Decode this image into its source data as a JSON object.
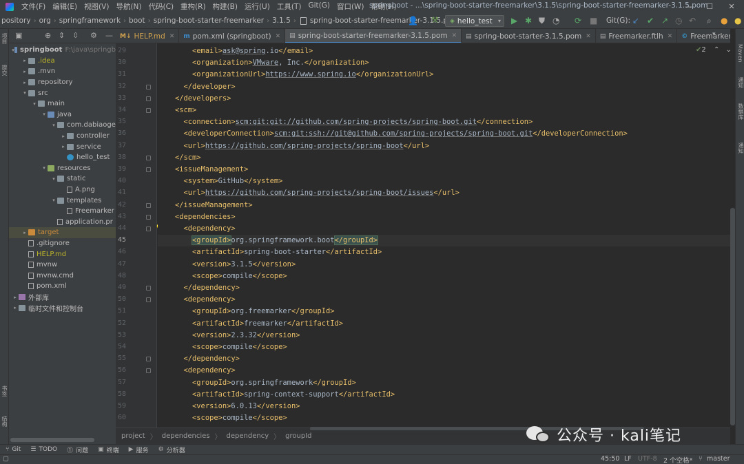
{
  "menubar": {
    "items": [
      "文件(F)",
      "编辑(E)",
      "视图(V)",
      "导航(N)",
      "代码(C)",
      "重构(R)",
      "构建(B)",
      "运行(U)",
      "工具(T)",
      "Git(G)",
      "窗口(W)",
      "帮助(H)"
    ],
    "window_title": "springboot - ...\\spring-boot-starter-freemarker\\3.1.5\\spring-boot-starter-freemarker-3.1.5.pom",
    "window_buttons": [
      "—",
      "☐",
      "✕"
    ]
  },
  "navbar": {
    "crumbs": [
      "pository",
      "org",
      "springframework",
      "boot",
      "spring-boot-starter-freemarker",
      "3.1.5"
    ],
    "file": "spring-boot-starter-freemarker-3.1.5.pom",
    "run_config": "hello_test",
    "git_label": "Git(G):"
  },
  "sidebar_stripe": {
    "left_top": "项目",
    "left_mid": "提交",
    "left_bottom1": "书签",
    "left_bottom2": "结构"
  },
  "right_stripe": {
    "maven": "Maven",
    "notify": "通知",
    "database": "数据库",
    "big_data": "通知"
  },
  "project_tree": [
    {
      "label": "springboot",
      "suffix": "F:\\java\\springb",
      "depth": 0,
      "arrow": "▾",
      "icon": "folder-b",
      "bold": true
    },
    {
      "label": ".idea",
      "depth": 1,
      "arrow": "▸",
      "icon": "folder",
      "style": "yellow"
    },
    {
      "label": ".mvn",
      "depth": 1,
      "arrow": "▸",
      "icon": "folder"
    },
    {
      "label": "repository",
      "depth": 1,
      "arrow": "▸",
      "icon": "folder"
    },
    {
      "label": "src",
      "depth": 1,
      "arrow": "▾",
      "icon": "folder"
    },
    {
      "label": "main",
      "depth": 2,
      "arrow": "▾",
      "icon": "folder"
    },
    {
      "label": "java",
      "depth": 3,
      "arrow": "▾",
      "icon": "folder-b"
    },
    {
      "label": "com.dabiaoge",
      "depth": 4,
      "arrow": "▾",
      "icon": "folder"
    },
    {
      "label": "controller",
      "depth": 5,
      "arrow": "▸",
      "icon": "folder"
    },
    {
      "label": "service",
      "depth": 5,
      "arrow": "▸",
      "icon": "folder"
    },
    {
      "label": "hello_test",
      "depth": 5,
      "arrow": "",
      "icon": "java"
    },
    {
      "label": "resources",
      "depth": 3,
      "arrow": "▾",
      "icon": "folder-g"
    },
    {
      "label": "static",
      "depth": 4,
      "arrow": "▾",
      "icon": "folder"
    },
    {
      "label": "A.png",
      "depth": 5,
      "arrow": "",
      "icon": "file"
    },
    {
      "label": "templates",
      "depth": 4,
      "arrow": "▾",
      "icon": "folder"
    },
    {
      "label": "Freemarker",
      "depth": 5,
      "arrow": "",
      "icon": "file"
    },
    {
      "label": "application.pr",
      "depth": 4,
      "arrow": "",
      "icon": "file"
    },
    {
      "label": "target",
      "depth": 1,
      "arrow": "▸",
      "icon": "folder-o",
      "style": "orange",
      "selected": true
    },
    {
      "label": ".gitignore",
      "depth": 1,
      "arrow": "",
      "icon": "file"
    },
    {
      "label": "HELP.md",
      "depth": 1,
      "arrow": "",
      "icon": "file",
      "style": "yellow"
    },
    {
      "label": "mvnw",
      "depth": 1,
      "arrow": "",
      "icon": "file"
    },
    {
      "label": "mvnw.cmd",
      "depth": 1,
      "arrow": "",
      "icon": "file"
    },
    {
      "label": "pom.xml",
      "depth": 1,
      "arrow": "",
      "icon": "file"
    },
    {
      "label": "外部库",
      "depth": 0,
      "arrow": "▸",
      "icon": "lib"
    },
    {
      "label": "临时文件和控制台",
      "depth": 0,
      "arrow": "▸",
      "icon": "folder"
    }
  ],
  "tabs": [
    {
      "label": "HELP.md",
      "icon": "M↓",
      "color": "#d0a24f"
    },
    {
      "label": "pom.xml (springboot)",
      "icon": "m",
      "color": "#bbbbbb"
    },
    {
      "label": "spring-boot-starter-freemarker-3.1.5.pom",
      "icon": "▤",
      "color": "#bbbbbb",
      "active": true
    },
    {
      "label": "spring-boot-starter-3.1.5.pom",
      "icon": "▤",
      "color": "#bbbbbb"
    },
    {
      "label": "Freemarker.ftlh",
      "icon": "▤",
      "color": "#bbbbbb"
    },
    {
      "label": "FreemarkerIndexCont",
      "icon": "©",
      "color": "#bbbbbb"
    }
  ],
  "editor": {
    "first_line": 29,
    "current_line": 45,
    "inspection_count": "2",
    "lines": [
      [
        {
          "t": "        "
        },
        {
          "c": "tg",
          "t": "<email>"
        },
        {
          "c": "ul",
          "t": "ask"
        },
        {
          "t": "@"
        },
        {
          "c": "ul",
          "t": "spring"
        },
        {
          "t": ".io"
        },
        {
          "c": "tg",
          "t": "</email>"
        }
      ],
      [
        {
          "t": "        "
        },
        {
          "c": "tg",
          "t": "<organization>"
        },
        {
          "c": "ul",
          "t": "VMware"
        },
        {
          "t": ", Inc."
        },
        {
          "c": "tg",
          "t": "</organization>"
        }
      ],
      [
        {
          "t": "        "
        },
        {
          "c": "tg",
          "t": "<organizationUrl>"
        },
        {
          "c": "ul",
          "t": "https://www.spring.io"
        },
        {
          "c": "tg",
          "t": "</organizationUrl>"
        }
      ],
      [
        {
          "t": "      "
        },
        {
          "c": "tg",
          "t": "</developer>"
        }
      ],
      [
        {
          "t": "    "
        },
        {
          "c": "tg",
          "t": "</developers>"
        }
      ],
      [
        {
          "t": "    "
        },
        {
          "c": "tg",
          "t": "<scm>"
        }
      ],
      [
        {
          "t": "      "
        },
        {
          "c": "tg",
          "t": "<connection>"
        },
        {
          "c": "ul",
          "t": "scm:git:git://github.com/spring-projects/spring-boot.git"
        },
        {
          "c": "tg",
          "t": "</connection>"
        }
      ],
      [
        {
          "t": "      "
        },
        {
          "c": "tg",
          "t": "<developerConnection>"
        },
        {
          "c": "ul",
          "t": "scm:git:ssh://git@github.com/spring-projects/spring-boot.git"
        },
        {
          "c": "tg",
          "t": "</developerConnection>"
        }
      ],
      [
        {
          "t": "      "
        },
        {
          "c": "tg",
          "t": "<url>"
        },
        {
          "c": "ul",
          "t": "https://github.com/spring-projects/spring-boot"
        },
        {
          "c": "tg",
          "t": "</url>"
        }
      ],
      [
        {
          "t": "    "
        },
        {
          "c": "tg",
          "t": "</scm>"
        }
      ],
      [
        {
          "t": "    "
        },
        {
          "c": "tg",
          "t": "<issueManagement>"
        }
      ],
      [
        {
          "t": "      "
        },
        {
          "c": "tg",
          "t": "<system>"
        },
        {
          "t": "GitHub"
        },
        {
          "c": "tg",
          "t": "</system>"
        }
      ],
      [
        {
          "t": "      "
        },
        {
          "c": "tg",
          "t": "<url>"
        },
        {
          "c": "ul",
          "t": "https://github.com/spring-projects/spring-boot/issues"
        },
        {
          "c": "tg",
          "t": "</url>"
        }
      ],
      [
        {
          "t": "    "
        },
        {
          "c": "tg",
          "t": "</issueManagement>"
        }
      ],
      [
        {
          "t": "    "
        },
        {
          "c": "tg",
          "t": "<dependencies>"
        }
      ],
      [
        {
          "t": "      "
        },
        {
          "c": "tg",
          "t": "<dependency>"
        }
      ],
      [
        {
          "t": "        "
        },
        {
          "c": "tg hl",
          "t": "<groupId>"
        },
        {
          "t": "org.springframework.boot"
        },
        {
          "c": "tg hl",
          "t": "</groupId>"
        }
      ],
      [
        {
          "t": "        "
        },
        {
          "c": "tg",
          "t": "<artifactId>"
        },
        {
          "t": "spring-boot-starter"
        },
        {
          "c": "tg",
          "t": "</artifactId>"
        }
      ],
      [
        {
          "t": "        "
        },
        {
          "c": "tg",
          "t": "<version>"
        },
        {
          "t": "3.1.5"
        },
        {
          "c": "tg",
          "t": "</version>"
        }
      ],
      [
        {
          "t": "        "
        },
        {
          "c": "tg",
          "t": "<scope>"
        },
        {
          "t": "compile"
        },
        {
          "c": "tg",
          "t": "</scope>"
        }
      ],
      [
        {
          "t": "      "
        },
        {
          "c": "tg",
          "t": "</dependency>"
        }
      ],
      [
        {
          "t": "      "
        },
        {
          "c": "tg",
          "t": "<dependency>"
        }
      ],
      [
        {
          "t": "        "
        },
        {
          "c": "tg",
          "t": "<groupId>"
        },
        {
          "t": "org.freemarker"
        },
        {
          "c": "tg",
          "t": "</groupId>"
        }
      ],
      [
        {
          "t": "        "
        },
        {
          "c": "tg",
          "t": "<artifactId>"
        },
        {
          "t": "freemarker"
        },
        {
          "c": "tg",
          "t": "</artifactId>"
        }
      ],
      [
        {
          "t": "        "
        },
        {
          "c": "tg",
          "t": "<version>"
        },
        {
          "t": "2.3.32"
        },
        {
          "c": "tg",
          "t": "</version>"
        }
      ],
      [
        {
          "t": "        "
        },
        {
          "c": "tg",
          "t": "<scope>"
        },
        {
          "t": "compile"
        },
        {
          "c": "tg",
          "t": "</scope>"
        }
      ],
      [
        {
          "t": "      "
        },
        {
          "c": "tg",
          "t": "</dependency>"
        }
      ],
      [
        {
          "t": "      "
        },
        {
          "c": "tg",
          "t": "<dependency>"
        }
      ],
      [
        {
          "t": "        "
        },
        {
          "c": "tg",
          "t": "<groupId>"
        },
        {
          "t": "org.springframework"
        },
        {
          "c": "tg",
          "t": "</groupId>"
        }
      ],
      [
        {
          "t": "        "
        },
        {
          "c": "tg",
          "t": "<artifactId>"
        },
        {
          "t": "spring-context-support"
        },
        {
          "c": "tg",
          "t": "</artifactId>"
        }
      ],
      [
        {
          "t": "        "
        },
        {
          "c": "tg",
          "t": "<version>"
        },
        {
          "t": "6.0.13"
        },
        {
          "c": "tg",
          "t": "</version>"
        }
      ],
      [
        {
          "t": "        "
        },
        {
          "c": "tg",
          "t": "<scope>"
        },
        {
          "t": "compile"
        },
        {
          "c": "tg",
          "t": "</scope>"
        }
      ]
    ]
  },
  "code_breadcrumb": [
    "project",
    "dependencies",
    "dependency",
    "groupId"
  ],
  "watermark": "公众号 · kali笔记",
  "toolwindows": [
    {
      "icon": "⑂",
      "label": "Git"
    },
    {
      "icon": "☰",
      "label": "TODO"
    },
    {
      "icon": "⓵",
      "label": "问题"
    },
    {
      "icon": "▣",
      "label": "终端"
    },
    {
      "icon": "▶",
      "label": "服务"
    },
    {
      "icon": "⚙",
      "label": "分析器"
    }
  ],
  "statusbar": {
    "position": "45:50",
    "line_sep": "LF",
    "encoding": "UTF-8",
    "indent": "2 个空格*",
    "branch": "master"
  }
}
